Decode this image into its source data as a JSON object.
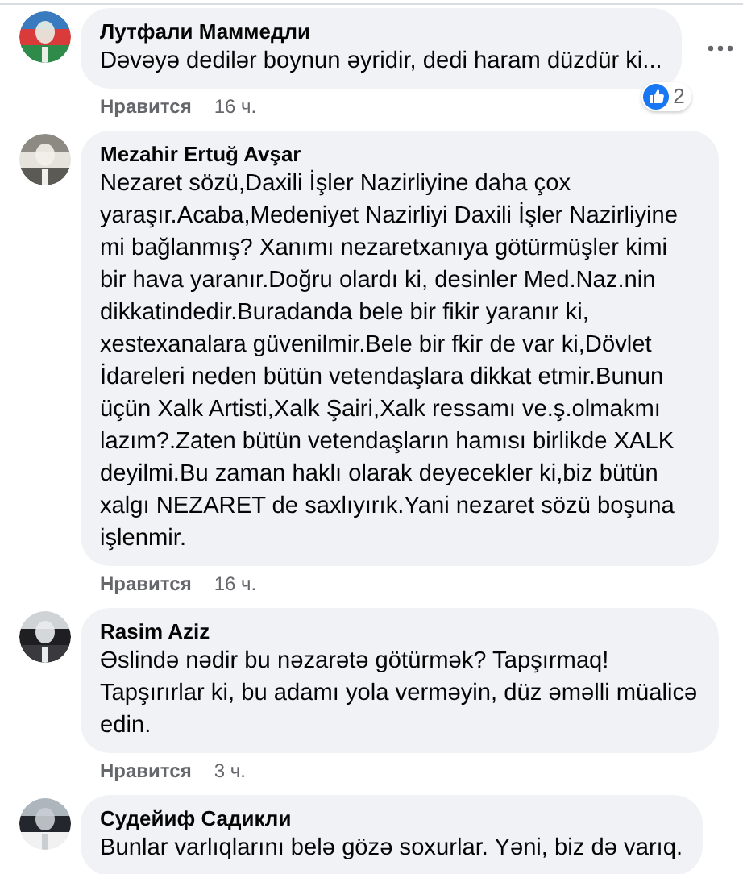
{
  "comments": [
    {
      "author": "Лутфали Маммедли",
      "text": "Dəvəyə dedilər boynun əyridir, dedi haram düzdür ki...",
      "menu_visible": true,
      "reactions": {
        "count": "2"
      },
      "actions": {
        "like": "Нравится",
        "time": "16 ч."
      }
    },
    {
      "author": "Mezahir Ertuğ Avşar",
      "text": "Nezaret sözü,Daxili İşler Nazirliyine daha çox yaraşır.Acaba,Medeniyet Nazirliyi Daxili İşler Nazirliyine mi bağlanmış? Xanımı nezaretxanıya götürmüşler kimi bir hava yaranır.Doğru olardı ki, desinler Med.Naz.nin dikkatindedir.Buradanda bele bir fikir yaranır ki, xestexanalara güvenilmir.Bele bir fkir de var ki,Dövlet İdareleri neden bütün vetendaşlara dikkat etmir.Bunun üçün Xalk Artisti,Xalk Şairi,Xalk ressamı ve.ş.olmakmı lazım?.Zaten bütün vetendaşların hamısı birlikde XALK deyilmi.Bu zaman haklı olarak deyecekler ki,biz bütün xalgı NEZARET de saxlıyırık.Yani nezaret sözü boşuna işlenmir.",
      "menu_visible": false,
      "actions": {
        "like": "Нравится",
        "time": "16 ч."
      }
    },
    {
      "author": "Rasim Aziz",
      "text": "Əslində nədir bu nəzarətə götürmək? Tapşırmaq! Tapşırırlar ki, bu adamı yola verməyin, düz əməlli müalicə edin.",
      "menu_visible": false,
      "actions": {
        "like": "Нравится",
        "time": "3 ч."
      }
    },
    {
      "author": "Судейиф Садикли",
      "text": "Bunlar varlıqlarını belə gözə soxurlar. Yəni, biz də varıq.",
      "menu_visible": false
    }
  ]
}
